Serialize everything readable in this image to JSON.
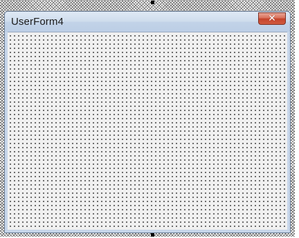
{
  "form": {
    "title": "UserForm4",
    "close_glyph": "✕"
  },
  "icons": {
    "close": "close-icon"
  },
  "colors": {
    "title_bar": "#c7d6ea",
    "close_button": "#c4432b",
    "client_area": "#f0f0f0",
    "grid_dots": "#1a1a1a"
  }
}
